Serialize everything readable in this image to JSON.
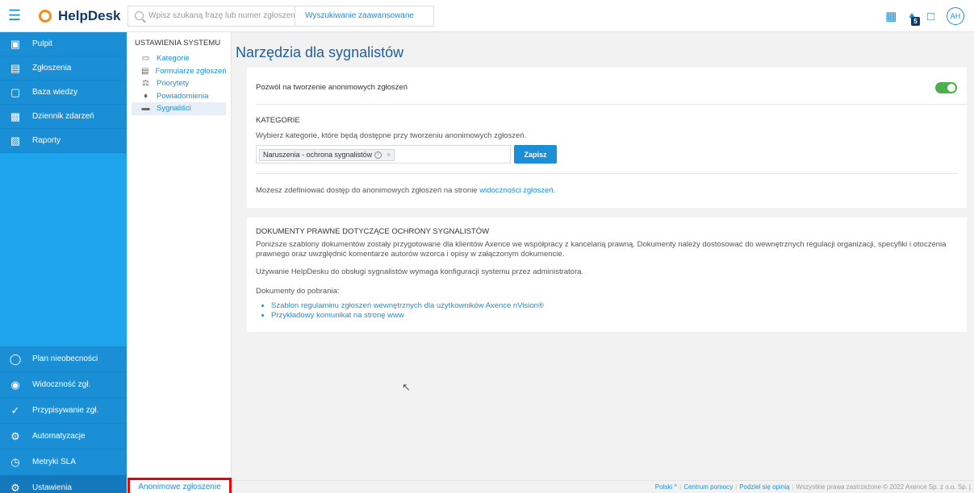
{
  "topbar": {
    "app_name": "HelpDesk",
    "search_placeholder": "Wpisz szukaną frazę lub numer zgłoszenia",
    "advanced_search": "Wyszukiwanie zaawansowane",
    "notification_count": "5",
    "avatar_initials": "AH",
    "icons": [
      "menu-icon",
      "apps-grid-icon",
      "bell-icon",
      "chat-icon"
    ]
  },
  "sidebar": {
    "items": [
      {
        "label": "Pulpit",
        "icon": "dashboard-icon"
      },
      {
        "label": "Zgłoszenia",
        "icon": "tickets-icon"
      },
      {
        "label": "Baza wiedzy",
        "icon": "knowledge-base-icon"
      },
      {
        "label": "Dziennik zdarzeń",
        "icon": "event-log-icon"
      },
      {
        "label": "Raporty",
        "icon": "reports-icon"
      }
    ],
    "bottom_items": [
      {
        "label": "Plan nieobecności",
        "icon": "absence-plan-icon"
      },
      {
        "label": "Widoczność zgł.",
        "icon": "visibility-icon"
      },
      {
        "label": "Przypisywanie zgł.",
        "icon": "assign-icon"
      },
      {
        "label": "Automatyzacje",
        "icon": "automation-icon"
      },
      {
        "label": "Metryki SLA",
        "icon": "sla-icon"
      },
      {
        "label": "Ustawienia",
        "icon": "settings-icon"
      }
    ]
  },
  "subnav": {
    "title": "USTAWIENIA SYSTEMU",
    "items": [
      {
        "label": "Kategorie",
        "icon": "folder-icon"
      },
      {
        "label": "Formularze zgłoszeń",
        "icon": "form-icon"
      },
      {
        "label": "Priorytety",
        "icon": "scale-icon"
      },
      {
        "label": "Powiadomienia",
        "icon": "bell-icon"
      },
      {
        "label": "Sygnaliści",
        "icon": "whistle-icon"
      }
    ],
    "bottom_button": "Anonimowe zgłoszenie"
  },
  "main": {
    "title": "Narzędzia dla sygnalistów",
    "allow_anonymous_label": "Pozwól na tworzenie anonimowych zgłoszeń",
    "allow_anonymous_enabled": true,
    "categories_title": "KATEGORIE",
    "categories_desc": "Wybierz kategorie, które będą dostępne przy tworzeniu anonimowych zgłoszeń.",
    "selected_tag": "Naruszenia - ochrona sygnalistów",
    "save_label": "Zapisz",
    "visibility_text": "Możesz zdefiniować dostęp do anonimowych zgłoszeń na stronie ",
    "visibility_link": "widoczności zgłoszeń.",
    "docs_title": "DOKUMENTY PRAWNE DOTYCZĄCE OCHRONY SYGNALISTÓW",
    "docs_para1": "Poniższe szablony dokumentów zostały przygotowane dla klientów Axence we współpracy z kancelarią prawną. Dokumenty należy dostosować do wewnętrznych regulacji organizacji, specyfiki i otoczenia prawnego oraz uwzględnić komentarze autorów wzorca i opisy w załączonym dokumencie.",
    "docs_para2": "Używanie HelpDesku do obsługi sygnalistów wymaga konfiguracji systemu przez administratora.",
    "docs_download_label": "Dokumenty do pobrania:",
    "docs": [
      "Szablon regulaminu zgłoszeń wewnętrznych dla użytkowników Axence nVision®",
      "Przykładowy komunikat na stronę www"
    ]
  },
  "footer": {
    "language": "Polski",
    "help_center": "Centrum pomocy",
    "feedback": "Podziel się opinią",
    "copyright": "Wszystkie prawa zastrzeżone © 2022 Axence Sp. z o.o. Sp. j."
  },
  "colors": {
    "primary": "#1b8fd6",
    "sidebar": "#1ea4ea",
    "toggle_on": "#4cae4c",
    "highlight_border": "#e00000"
  }
}
